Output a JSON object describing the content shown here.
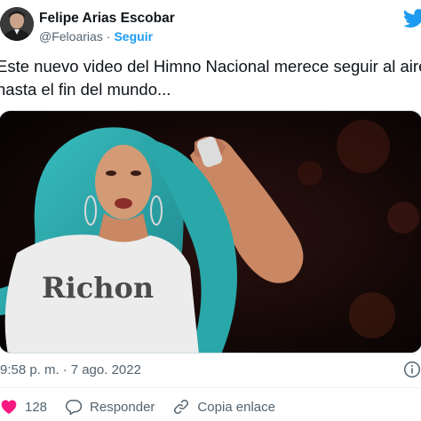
{
  "author": {
    "name": "Felipe Arias Escobar",
    "handle": "@Feloarias",
    "separator": "·",
    "follow_label": "Seguir"
  },
  "tweet": {
    "text_line1": "Este nuevo video del Himno Nacional merece seguir al aire",
    "text_line2": "hasta el fin del mundo..."
  },
  "media": {
    "shirt_text": "Richon"
  },
  "meta": {
    "time": "9:58 p. m.",
    "separator": "·",
    "date": "7 ago. 2022"
  },
  "actions": {
    "like_count": "128",
    "reply_label": "Responder",
    "copy_link_label": "Copia enlace"
  },
  "colors": {
    "accent": "#1d9bf0",
    "secondary_text": "#536471",
    "like_red": "#f91880",
    "hair": "#2aa7a9"
  },
  "icons": {
    "brand": "twitter-bird-icon",
    "info": "info-icon",
    "like": "heart-icon",
    "reply": "reply-bubble-icon",
    "copy": "link-icon"
  }
}
